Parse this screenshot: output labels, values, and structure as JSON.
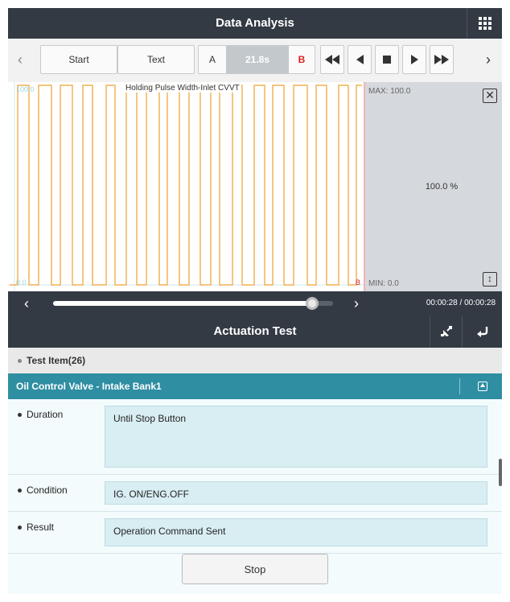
{
  "header": {
    "title": "Data Analysis",
    "menu_icon": "grid-icon"
  },
  "toolbar": {
    "prev_icon": "chevron-left-icon",
    "start_label": "Start",
    "text_label": "Text",
    "marker_a": "A",
    "marker_time": "21.8s",
    "marker_b": "B",
    "buttons": [
      "rewind-icon",
      "step-back-icon",
      "stop-icon",
      "play-icon",
      "fast-forward-icon"
    ],
    "next_icon": "chevron-right-icon"
  },
  "graph": {
    "title": "Holding Pulse Width-Inlet CVVT",
    "y_top_label": "100.0",
    "y_bottom_label": "0.0",
    "marker_b": "B",
    "line_color": "#f0a030",
    "pulse_high": 100,
    "pulse_low": 0
  },
  "side_panel": {
    "max_label": "MAX: 100.0",
    "min_label": "MIN: 0.0",
    "current_value": "100.0 %"
  },
  "scrubber": {
    "progress": 0.925,
    "time": "00:00:28 / 00:00:28"
  },
  "actuation": {
    "title": "Actuation Test",
    "test_item_label": "Test Item(26)",
    "selected_item": "Oil Control Valve - Intake Bank1",
    "fields": [
      {
        "label": "Duration",
        "value": "Until Stop Button"
      },
      {
        "label": "Condition",
        "value": "IG. ON/ENG.OFF"
      },
      {
        "label": "Result",
        "value": "Operation Command Sent"
      }
    ],
    "stop_label": "Stop"
  },
  "colors": {
    "header_bg": "#333a44",
    "teal_bar": "#2f8ea2",
    "marker_b_red": "#d9201f",
    "signal_orange": "#f0a030"
  }
}
